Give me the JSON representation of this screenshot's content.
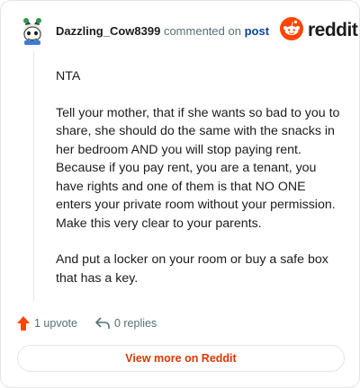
{
  "header": {
    "username": "Dazzling_Cow8399",
    "commented_on": "commented on",
    "post_link": "post",
    "brand_name": "reddit",
    "avatar_icon": "snoo-avatar-icon",
    "brand_icon": "reddit-logo-icon"
  },
  "comment": {
    "paragraphs": [
      "NTA",
      "Tell your mother, that if she wants so bad to you to share, she should do the same with the snacks in her bedroom AND you will stop paying rent. Because if you pay rent, you are a tenant, you have rights and one of them is that NO ONE enters your private room without your permission. Make this very clear to your parents.",
      "And put a locker on your room or buy a safe box that has a key."
    ]
  },
  "actions": {
    "upvote_label": "1 upvote",
    "replies_label": "0 replies",
    "upvote_icon": "upvote-arrow-icon",
    "reply_icon": "reply-icon"
  },
  "footer": {
    "view_more_label": "View more on Reddit"
  },
  "colors": {
    "accent": "#d93900",
    "upvote": "#ff4500",
    "link": "#0a449b",
    "muted": "#576f76"
  }
}
